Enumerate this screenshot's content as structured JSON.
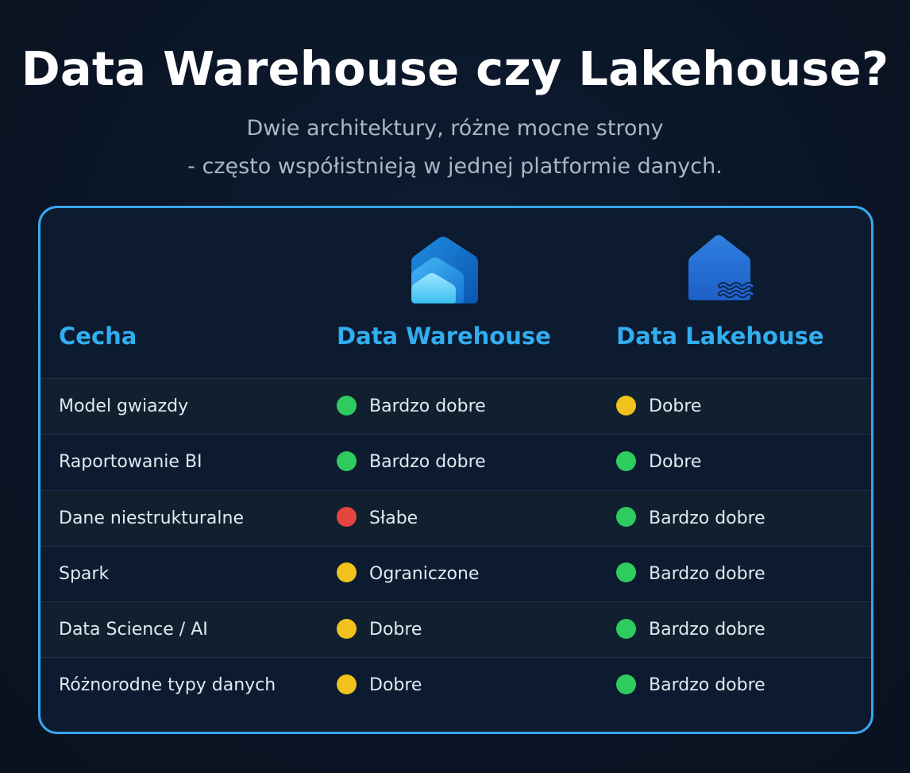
{
  "header": {
    "title": "Data Warehouse czy Lakehouse?",
    "subtitle_line1": "Dwie architektury, różne mocne strony",
    "subtitle_line2": "- często współistnieją w jednej platformie danych."
  },
  "colors": {
    "accent": "#32aef0",
    "border": "#3aa6ef",
    "good": "#2ecc5f",
    "medium": "#f1c21b",
    "weak": "#e5453f"
  },
  "icons": {
    "warehouse": "warehouse-house-icon",
    "lakehouse": "lakehouse-house-waves-icon"
  },
  "table": {
    "columns": [
      "Cecha",
      "Data Warehouse",
      "Data Lakehouse"
    ],
    "rows": [
      {
        "feature": "Model gwiazdy",
        "warehouse": {
          "label": "Bardzo dobre",
          "level": "good"
        },
        "lakehouse": {
          "label": "Dobre",
          "level": "medium"
        }
      },
      {
        "feature": "Raportowanie BI",
        "warehouse": {
          "label": "Bardzo dobre",
          "level": "good"
        },
        "lakehouse": {
          "label": "Dobre",
          "level": "good"
        }
      },
      {
        "feature": "Dane niestrukturalne",
        "warehouse": {
          "label": "Słabe",
          "level": "weak"
        },
        "lakehouse": {
          "label": "Bardzo dobre",
          "level": "good"
        }
      },
      {
        "feature": "Spark",
        "warehouse": {
          "label": "Ograniczone",
          "level": "medium"
        },
        "lakehouse": {
          "label": "Bardzo dobre",
          "level": "good"
        }
      },
      {
        "feature": "Data Science / AI",
        "warehouse": {
          "label": "Dobre",
          "level": "medium"
        },
        "lakehouse": {
          "label": "Bardzo dobre",
          "level": "good"
        }
      },
      {
        "feature": "Różnorodne typy danych",
        "warehouse": {
          "label": "Dobre",
          "level": "medium"
        },
        "lakehouse": {
          "label": "Bardzo dobre",
          "level": "good"
        }
      }
    ]
  }
}
